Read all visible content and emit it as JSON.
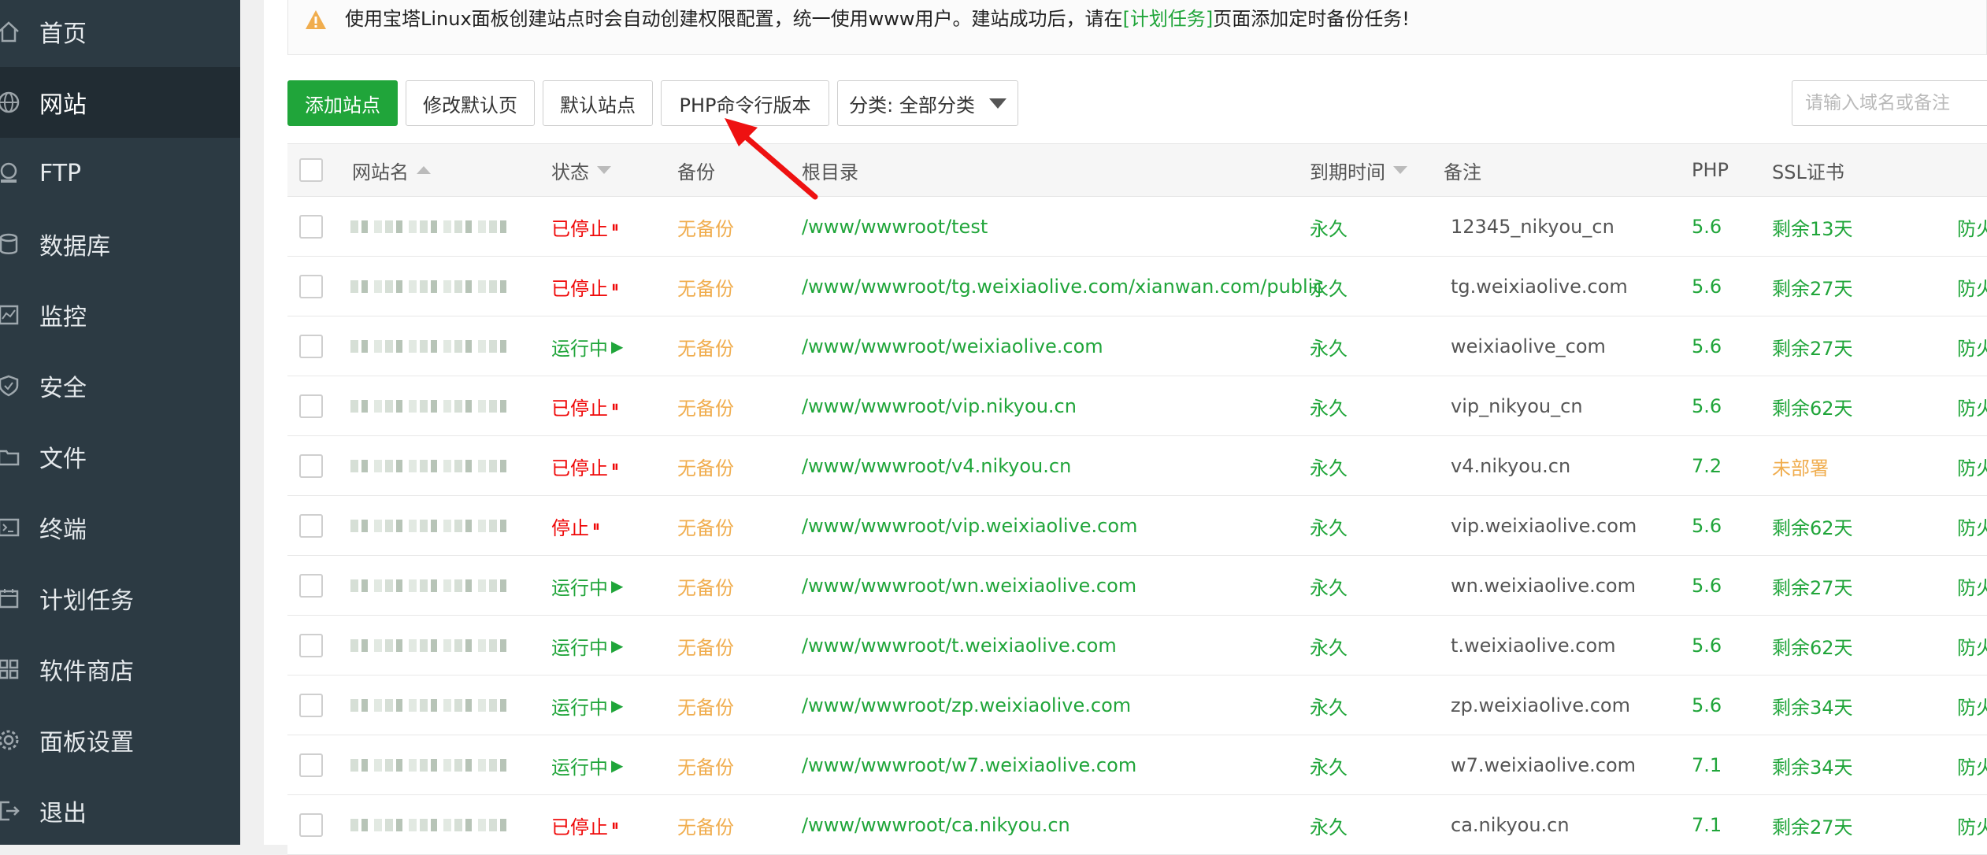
{
  "sidebar": {
    "items": [
      {
        "label": "首页",
        "icon": "home-icon"
      },
      {
        "label": "网站",
        "icon": "globe-icon",
        "active": true
      },
      {
        "label": "FTP",
        "icon": "ftp-icon"
      },
      {
        "label": "数据库",
        "icon": "database-icon"
      },
      {
        "label": "监控",
        "icon": "monitor-icon"
      },
      {
        "label": "安全",
        "icon": "shield-icon"
      },
      {
        "label": "文件",
        "icon": "folder-icon"
      },
      {
        "label": "终端",
        "icon": "terminal-icon"
      },
      {
        "label": "计划任务",
        "icon": "calendar-icon"
      },
      {
        "label": "软件商店",
        "icon": "apps-icon"
      },
      {
        "label": "面板设置",
        "icon": "gear-icon"
      },
      {
        "label": "退出",
        "icon": "logout-icon"
      }
    ]
  },
  "notice": {
    "text_before": "使用宝塔Linux面板创建站点时会自动创建权限配置，统一使用www用户。建站成功后，请在",
    "link": "[计划任务]",
    "text_after": "页面添加定时备份任务!",
    "icon": "warning-icon"
  },
  "toolbar": {
    "add_site": "添加站点",
    "modify_default_page": "修改默认页",
    "default_site": "默认站点",
    "php_cli_version": "PHP命令行版本",
    "category_select": "分类: 全部分类",
    "search_placeholder": "请输入域名或备注"
  },
  "table": {
    "headers": {
      "name": "网站名",
      "status": "状态",
      "backup": "备份",
      "root": "根目录",
      "expiry": "到期时间",
      "remark": "备注",
      "php": "PHP",
      "ssl": "SSL证书"
    },
    "rows": [
      {
        "status": "已停止",
        "status_icon": "pause-icon",
        "status_type": "stopped",
        "backup": "无备份",
        "root": "/www/wwwroot/test",
        "expiry": "永久",
        "remark": "12345_nikyou_cn",
        "php": "5.6",
        "ssl": "剩余13天",
        "ssl_type": "ok",
        "action": "防火"
      },
      {
        "status": "已停止",
        "status_icon": "pause-icon",
        "status_type": "stopped",
        "backup": "无备份",
        "root": "/www/wwwroot/tg.weixiaolive.com/xianwan.com/public",
        "expiry": "永久",
        "remark": "tg.weixiaolive.com",
        "php": "5.6",
        "ssl": "剩余27天",
        "ssl_type": "ok",
        "action": "防火"
      },
      {
        "status": "运行中",
        "status_icon": "play-icon",
        "status_type": "running",
        "backup": "无备份",
        "root": "/www/wwwroot/weixiaolive.com",
        "expiry": "永久",
        "remark": "weixiaolive_com",
        "php": "5.6",
        "ssl": "剩余27天",
        "ssl_type": "ok",
        "action": "防火"
      },
      {
        "status": "已停止",
        "status_icon": "pause-icon",
        "status_type": "stopped",
        "backup": "无备份",
        "root": "/www/wwwroot/vip.nikyou.cn",
        "expiry": "永久",
        "remark": "vip_nikyou_cn",
        "php": "5.6",
        "ssl": "剩余62天",
        "ssl_type": "ok",
        "action": "防火"
      },
      {
        "status": "已停止",
        "status_icon": "pause-icon",
        "status_type": "stopped",
        "backup": "无备份",
        "root": "/www/wwwroot/v4.nikyou.cn",
        "expiry": "永久",
        "remark": "v4.nikyou.cn",
        "php": "7.2",
        "ssl": "未部署",
        "ssl_type": "none",
        "action": "防火"
      },
      {
        "status": "停止",
        "status_icon": "pause-icon",
        "status_type": "stopped",
        "backup": "无备份",
        "root": "/www/wwwroot/vip.weixiaolive.com",
        "expiry": "永久",
        "remark": "vip.weixiaolive.com",
        "php": "5.6",
        "ssl": "剩余62天",
        "ssl_type": "ok",
        "action": "防火"
      },
      {
        "status": "运行中",
        "status_icon": "play-icon",
        "status_type": "running",
        "backup": "无备份",
        "root": "/www/wwwroot/wn.weixiaolive.com",
        "expiry": "永久",
        "remark": "wn.weixiaolive.com",
        "php": "5.6",
        "ssl": "剩余27天",
        "ssl_type": "ok",
        "action": "防火"
      },
      {
        "status": "运行中",
        "status_icon": "play-icon",
        "status_type": "running",
        "backup": "无备份",
        "root": "/www/wwwroot/t.weixiaolive.com",
        "expiry": "永久",
        "remark": "t.weixiaolive.com",
        "php": "5.6",
        "ssl": "剩余62天",
        "ssl_type": "ok",
        "action": "防火"
      },
      {
        "status": "运行中",
        "status_icon": "play-icon",
        "status_type": "running",
        "backup": "无备份",
        "root": "/www/wwwroot/zp.weixiaolive.com",
        "expiry": "永久",
        "remark": "zp.weixiaolive.com",
        "php": "5.6",
        "ssl": "剩余34天",
        "ssl_type": "ok",
        "action": "防火"
      },
      {
        "status": "运行中",
        "status_icon": "play-icon",
        "status_type": "running",
        "backup": "无备份",
        "root": "/www/wwwroot/w7.weixiaolive.com",
        "expiry": "永久",
        "remark": "w7.weixiaolive.com",
        "php": "7.1",
        "ssl": "剩余34天",
        "ssl_type": "ok",
        "action": "防火"
      },
      {
        "status": "已停止",
        "status_icon": "pause-icon",
        "status_type": "stopped",
        "backup": "无备份",
        "root": "/www/wwwroot/ca.nikyou.cn",
        "expiry": "永久",
        "remark": "ca.nikyou.cn",
        "php": "7.1",
        "ssl": "剩余27天",
        "ssl_type": "ok",
        "action": "防火"
      }
    ]
  },
  "colors": {
    "brand_green": "#20a53a",
    "stopped_red": "#ef0808",
    "warning_orange": "#f0ad4e",
    "sidebar_bg": "#2c3a43",
    "sidebar_active_bg": "#212c33"
  },
  "annotation": {
    "icon": "red-arrow-icon"
  }
}
